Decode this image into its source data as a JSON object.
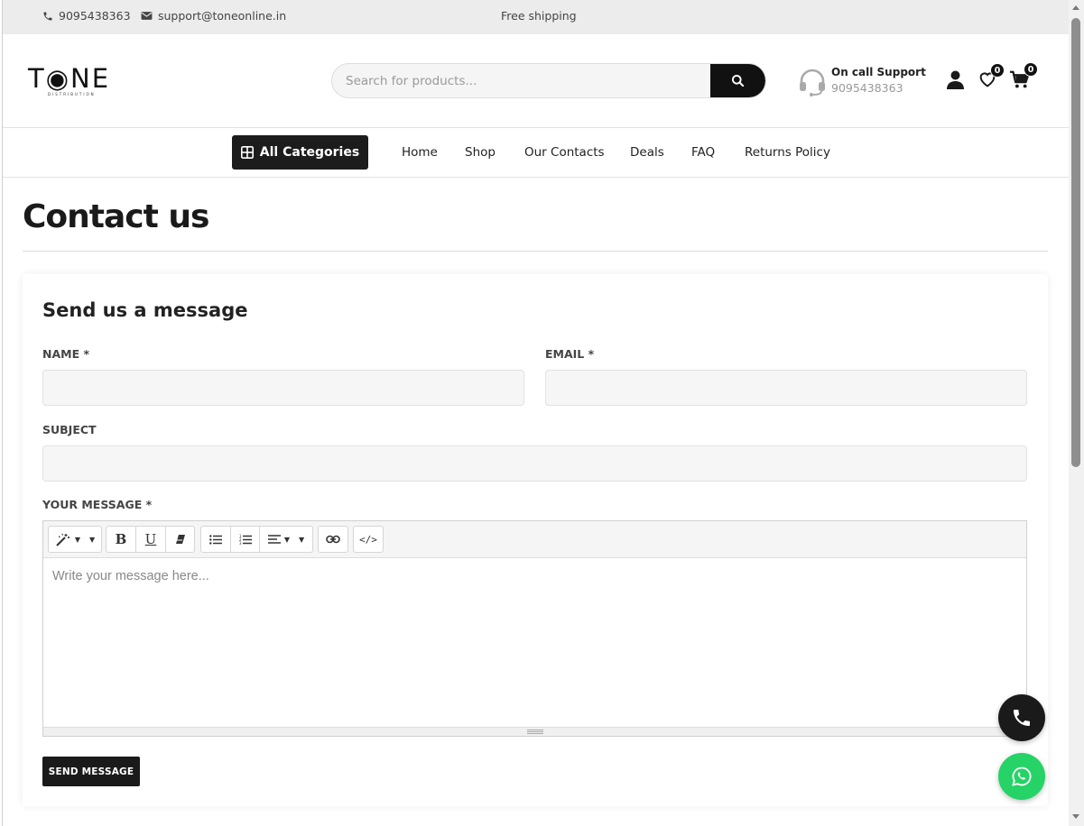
{
  "topbar": {
    "phone": "9095438363",
    "email": "support@toneonline.in",
    "shipping": "Free shipping"
  },
  "header": {
    "logo_text": "T◉NE",
    "logo_sub": "DISTRIBUTION",
    "search_placeholder": "Search for products...",
    "support_title": "On call Support",
    "support_number": "9095438363",
    "wishlist_count": "0",
    "cart_count": "0"
  },
  "nav": {
    "all_categories": "All Categories",
    "links": [
      "Home",
      "Shop",
      "Our Contacts",
      "Deals",
      "FAQ",
      "Returns Policy"
    ]
  },
  "page": {
    "title": "Contact us"
  },
  "form": {
    "heading": "Send us a message",
    "name_label": "NAME *",
    "email_label": "EMAIL *",
    "subject_label": "SUBJECT",
    "message_label": "YOUR MESSAGE *",
    "message_placeholder": "Write your message here...",
    "submit_label": "SEND MESSAGE"
  },
  "toolbar": {
    "bold": "B",
    "underline": "U",
    "code": "</>"
  },
  "colors": {
    "accent": "#111111",
    "whatsapp": "#25d366",
    "topbar_bg": "#ececec"
  }
}
